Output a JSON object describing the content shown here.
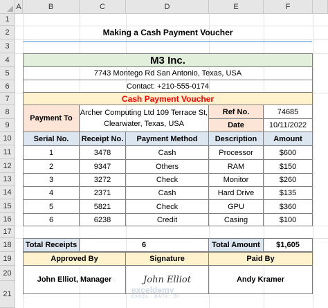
{
  "columns": [
    "A",
    "B",
    "C",
    "D",
    "E",
    "F"
  ],
  "rows": [
    "1",
    "2",
    "3",
    "4",
    "5",
    "6",
    "7",
    "8",
    "9",
    "10",
    "11",
    "12",
    "13",
    "14",
    "15",
    "16",
    "17",
    "18",
    "19",
    "20",
    "21"
  ],
  "sheet_title": "Making a Cash Payment Voucher",
  "company": {
    "name": "M3 Inc.",
    "address": "7743 Montego Rd San Antonio, Texas, USA",
    "contact": "Contact: +210-555-0174"
  },
  "voucher_title": "Cash Payment Voucher",
  "payment_to_label": "Payment To",
  "payment_to_line1": "Archer Computing Ltd 109 Terrace St,",
  "payment_to_line2": "Clearwater, Texas, USA",
  "ref_label": "Ref No.",
  "ref_value": "74685",
  "date_label": "Date",
  "date_value": "10/11/2022",
  "table": {
    "headers": [
      "Serial No.",
      "Receipt No.",
      "Payment Method",
      "Description",
      "Amount"
    ],
    "rows": [
      [
        "1",
        "3478",
        "Cash",
        "Processor",
        "$600"
      ],
      [
        "2",
        "9347",
        "Others",
        "RAM",
        "$150"
      ],
      [
        "3",
        "3272",
        "Check",
        "Monitor",
        "$260"
      ],
      [
        "4",
        "2371",
        "Cash",
        "Hard Drive",
        "$135"
      ],
      [
        "5",
        "5821",
        "Check",
        "GPU",
        "$360"
      ],
      [
        "6",
        "6238",
        "Credit",
        "Casing",
        "$100"
      ]
    ]
  },
  "totals": {
    "receipts_label": "Total Receipts",
    "receipts_value": "6",
    "amount_label": "Total Amount",
    "amount_value": "$1,605"
  },
  "footer": {
    "approved_label": "Approved By",
    "signature_label": "Signature",
    "paid_label": "Paid By",
    "approved_value": "John Elliot, Manager",
    "signature_value": "John Elliot",
    "paid_value": "Andy Kramer"
  },
  "watermark": {
    "brand": "exceldemy",
    "tagline": "EXCEL · DATA · BI"
  },
  "colors": {
    "accent_blue": "#dce6f1",
    "peach": "#fce4d6",
    "cream": "#fff2cc",
    "green": "#e2efda",
    "red": "#ff0000"
  }
}
